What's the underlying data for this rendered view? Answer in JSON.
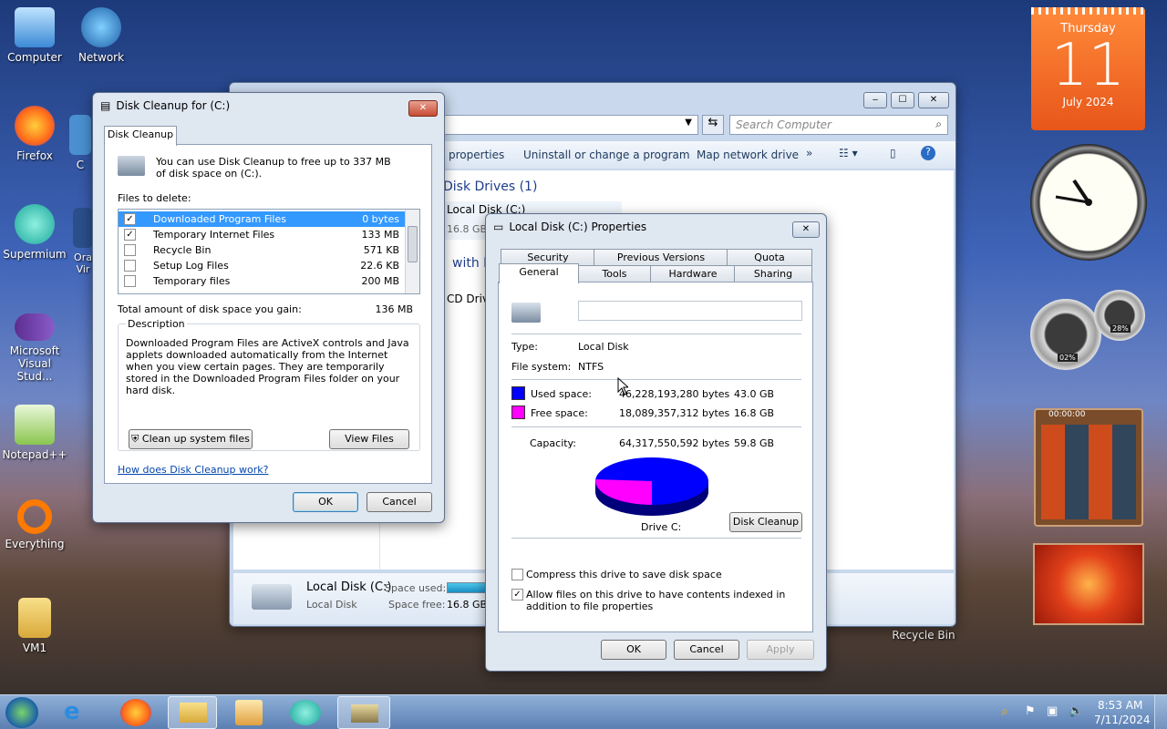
{
  "desktop": {
    "icons": [
      "Computer",
      "Network",
      "Firefox",
      "C",
      "Supermium",
      "Ora Vir",
      "Microsoft Visual Stud...",
      "Notepad++",
      "Everything",
      "VM1",
      "Recycle Bin"
    ]
  },
  "calendar": {
    "weekday": "Thursday",
    "day": "11",
    "month_year": "July 2024"
  },
  "meters": {
    "cpu": "02%",
    "ram": "28%"
  },
  "timer": "00:00:00",
  "explorer": {
    "search_placeholder": "Search Computer",
    "toolbar": [
      "properties",
      "Uninstall or change a program",
      "Map network drive",
      "»"
    ],
    "section_hdd": "Disk Drives (1)",
    "drive_name": "Local Disk (C:)",
    "drive_free_short": "16.8 GB",
    "section_removable": "with R",
    "cd_drive": "CD Drive",
    "details": {
      "name": "Local Disk (C:)",
      "type": "Local Disk",
      "space_used_label": "Space used:",
      "space_free_label": "Space free:",
      "space_free": "16.8 GB"
    }
  },
  "cleanup": {
    "title": "Disk Cleanup for  (C:)",
    "tab": "Disk Cleanup",
    "intro": "You can use Disk Cleanup to free up to 337 MB of disk space on  (C:).",
    "files_label": "Files to delete:",
    "files": [
      {
        "name": "Downloaded Program Files",
        "size": "0 bytes",
        "checked": true
      },
      {
        "name": "Temporary Internet Files",
        "size": "133 MB",
        "checked": true
      },
      {
        "name": "Recycle Bin",
        "size": "571 KB",
        "checked": false
      },
      {
        "name": "Setup Log Files",
        "size": "22.6 KB",
        "checked": false
      },
      {
        "name": "Temporary files",
        "size": "200 MB",
        "checked": false
      }
    ],
    "total_label": "Total amount of disk space you gain:",
    "total_value": "136 MB",
    "desc_label": "Description",
    "desc_text": "Downloaded Program Files are ActiveX controls and Java applets downloaded automatically from the Internet when you view certain pages. They are temporarily stored in the Downloaded Program Files folder on your hard disk.",
    "cleanup_system_btn": "Clean up system files",
    "view_files_btn": "View Files",
    "help_link": "How does Disk Cleanup work?",
    "ok": "OK",
    "cancel": "Cancel"
  },
  "props": {
    "title": "Local Disk (C:) Properties",
    "tabs_row1": [
      "Security",
      "Previous Versions",
      "Quota"
    ],
    "tabs_row2": [
      "General",
      "Tools",
      "Hardware",
      "Sharing"
    ],
    "name_value": "",
    "type_label": "Type:",
    "type_value": "Local Disk",
    "fs_label": "File system:",
    "fs_value": "NTFS",
    "used_label": "Used space:",
    "used_bytes": "46,228,193,280 bytes",
    "used_gb": "43.0 GB",
    "free_label": "Free space:",
    "free_bytes": "18,089,357,312 bytes",
    "free_gb": "16.8 GB",
    "cap_label": "Capacity:",
    "cap_bytes": "64,317,550,592 bytes",
    "cap_gb": "59.8 GB",
    "drive_label": "Drive C:",
    "disk_cleanup_btn": "Disk Cleanup",
    "compress_label": "Compress this drive to save disk space",
    "index_label": "Allow files on this drive to have contents indexed in addition to file properties",
    "ok": "OK",
    "cancel": "Cancel",
    "apply": "Apply",
    "colors": {
      "used": "#0000ff",
      "free": "#ff00ff"
    }
  },
  "taskbar": {
    "time": "8:53 AM",
    "date": "7/11/2024"
  }
}
